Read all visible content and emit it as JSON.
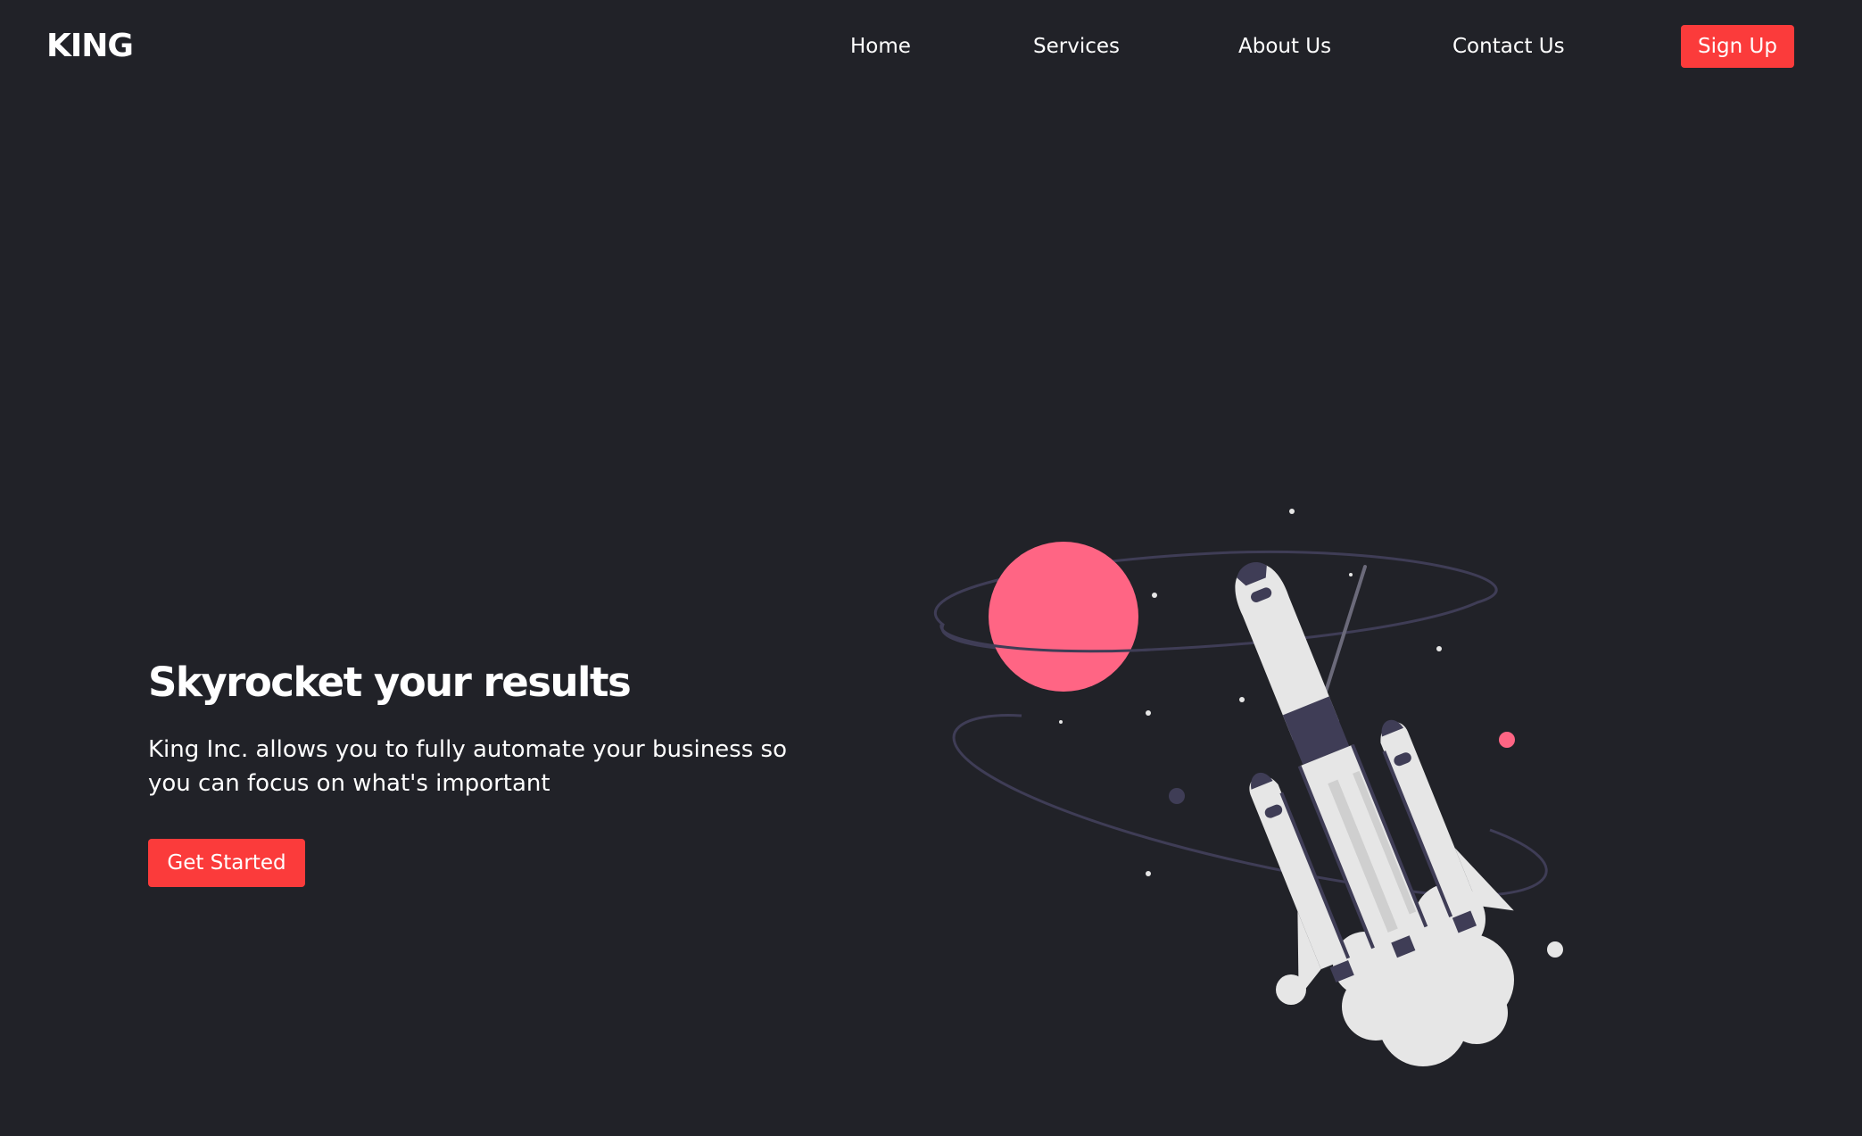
{
  "brand": {
    "logo_text": "KING"
  },
  "nav": {
    "items": [
      {
        "label": "Home"
      },
      {
        "label": "Services"
      },
      {
        "label": "About Us"
      },
      {
        "label": "Contact Us"
      }
    ],
    "signup_label": "Sign Up"
  },
  "hero": {
    "title": "Skyrocket your results",
    "description": "King Inc. allows you to fully automate your business so you can focus on what's important",
    "cta_label": "Get Started"
  },
  "colors": {
    "background": "#212228",
    "accent": "#fb3b3b",
    "planet": "#ff6584",
    "rocket_body": "#e6e6e6",
    "rocket_dark": "#3f3d56"
  },
  "illustration": {
    "icon": "rocket-launch-illustration"
  }
}
